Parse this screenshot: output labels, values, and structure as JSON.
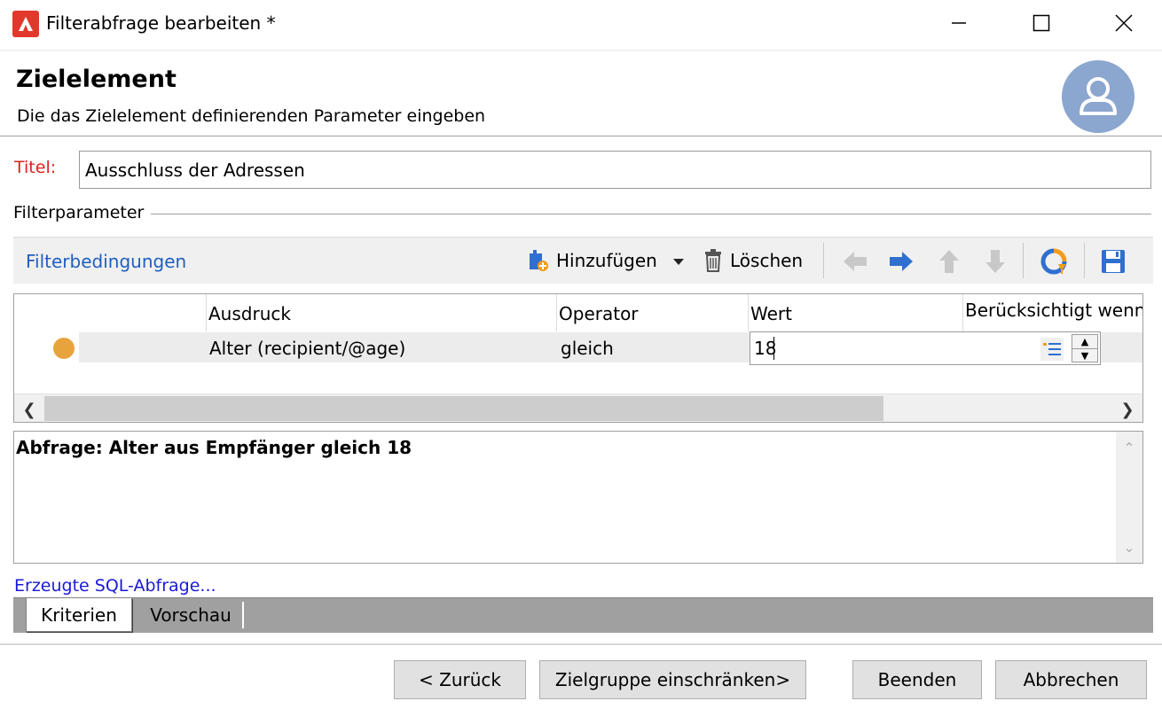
{
  "window": {
    "title": "Filterabfrage bearbeiten *",
    "minimize_label": "—",
    "maximize_label": "☐",
    "close_label": "✕"
  },
  "header": {
    "title": "Zielelement",
    "subtitle": "Die das Zielelement definierenden Parameter eingeben"
  },
  "titel_field": {
    "label": "Titel:",
    "value": "Ausschluss der Adressen"
  },
  "filter_group": {
    "label": "Filterparameter"
  },
  "toolbar": {
    "title": "Filterbedingungen",
    "add_label": "Hinzufügen",
    "delete_label": "Löschen",
    "icons": [
      "add-condition-icon",
      "dropdown-arrow-icon",
      "trash-icon",
      "arrow-left-icon",
      "arrow-right-icon",
      "arrow-up-icon",
      "arrow-down-icon",
      "filter-refresh-icon",
      "save-icon"
    ]
  },
  "grid": {
    "columns": [
      "Ausdruck",
      "Operator",
      "Wert",
      "Berücksichtigt wenn"
    ],
    "rows": [
      {
        "status_color": "#e8a43c",
        "expression": "Alter (recipient/@age)",
        "operator": "gleich",
        "value": "18"
      }
    ]
  },
  "query": {
    "text": "Abfrage: Alter aus Empfänger gleich 18"
  },
  "sql_link": "Erzeugte SQL-Abfrage...",
  "tabs": [
    {
      "label": "Kriterien",
      "active": true
    },
    {
      "label": "Vorschau",
      "active": false
    }
  ],
  "buttons": {
    "back": "< Zurück",
    "restrict": "Zielgruppe einschränken>",
    "finish": "Beenden",
    "cancel": "Abbrechen"
  },
  "colors": {
    "titel_label": "#e0201e",
    "link_blue": "#1f5fbf",
    "avatar": "#8ba6cf",
    "brand_red": "#e2382b"
  }
}
